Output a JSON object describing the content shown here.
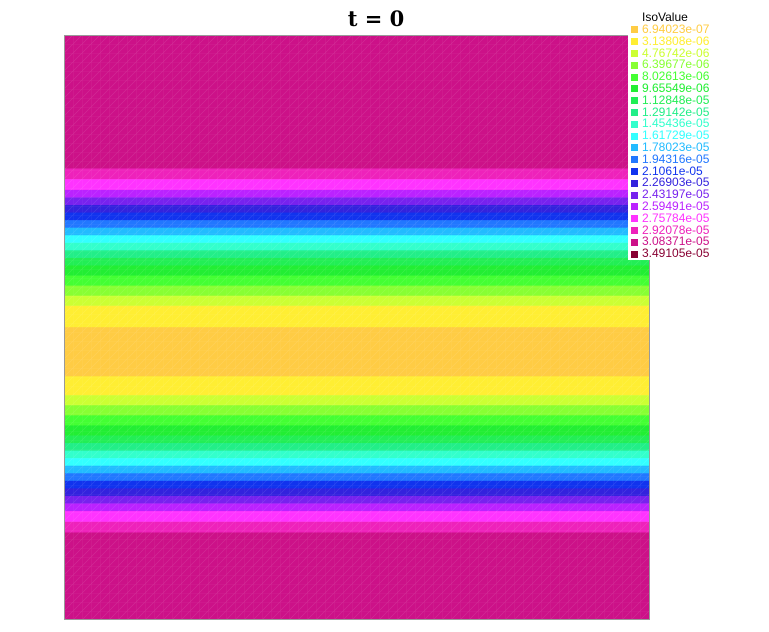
{
  "chart_data": {
    "type": "heatmap",
    "title": "t = 0",
    "legend_title": "IsoValue",
    "legend_placement": "top-right",
    "grid": false,
    "levels": [
      {
        "label": "6.94023e-07",
        "color": "#ffcc44"
      },
      {
        "label": "3.13808e-06",
        "color": "#ffee33"
      },
      {
        "label": "4.76742e-06",
        "color": "#ccff33"
      },
      {
        "label": "6.39677e-06",
        "color": "#88ff33"
      },
      {
        "label": "8.02613e-06",
        "color": "#44ff33"
      },
      {
        "label": "9.65549e-06",
        "color": "#22ee33"
      },
      {
        "label": "1.12848e-05",
        "color": "#22ee55"
      },
      {
        "label": "1.29142e-05",
        "color": "#22ee88"
      },
      {
        "label": "1.45436e-05",
        "color": "#33ffcc"
      },
      {
        "label": "1.61729e-05",
        "color": "#33ffff"
      },
      {
        "label": "1.78023e-05",
        "color": "#22bbff"
      },
      {
        "label": "1.94316e-05",
        "color": "#2277ff"
      },
      {
        "label": "2.1061e-05",
        "color": "#1133ee"
      },
      {
        "label": "2.26903e-05",
        "color": "#3322dd"
      },
      {
        "label": "2.43197e-05",
        "color": "#7722ee"
      },
      {
        "label": "2.59491e-05",
        "color": "#bb22ff"
      },
      {
        "label": "2.75784e-05",
        "color": "#ff33ff"
      },
      {
        "label": "2.92078e-05",
        "color": "#ee22bb"
      },
      {
        "label": "3.08371e-05",
        "color": "#cc1188"
      },
      {
        "label": "3.49105e-05",
        "color": "#880033"
      }
    ],
    "bands_top_to_bottom": [
      {
        "level": 18,
        "extent": 0.212
      },
      {
        "level": 17,
        "extent": 0.017
      },
      {
        "level": 16,
        "extent": 0.017
      },
      {
        "level": 15,
        "extent": 0.012
      },
      {
        "level": 14,
        "extent": 0.012
      },
      {
        "level": 13,
        "extent": 0.012
      },
      {
        "level": 12,
        "extent": 0.012
      },
      {
        "level": 11,
        "extent": 0.012
      },
      {
        "level": 10,
        "extent": 0.012
      },
      {
        "level": 9,
        "extent": 0.012
      },
      {
        "level": 8,
        "extent": 0.012
      },
      {
        "level": 7,
        "extent": 0.012
      },
      {
        "level": 6,
        "extent": 0.012
      },
      {
        "level": 5,
        "extent": 0.016
      },
      {
        "level": 4,
        "extent": 0.016
      },
      {
        "level": 3,
        "extent": 0.016
      },
      {
        "level": 2,
        "extent": 0.016
      },
      {
        "level": 1,
        "extent": 0.034
      },
      {
        "level": 0,
        "extent": 0.078
      },
      {
        "level": 1,
        "extent": 0.03
      },
      {
        "level": 2,
        "extent": 0.016
      },
      {
        "level": 3,
        "extent": 0.016
      },
      {
        "level": 4,
        "extent": 0.016
      },
      {
        "level": 5,
        "extent": 0.016
      },
      {
        "level": 6,
        "extent": 0.012
      },
      {
        "level": 7,
        "extent": 0.012
      },
      {
        "level": 8,
        "extent": 0.012
      },
      {
        "level": 9,
        "extent": 0.012
      },
      {
        "level": 10,
        "extent": 0.012
      },
      {
        "level": 11,
        "extent": 0.012
      },
      {
        "level": 12,
        "extent": 0.012
      },
      {
        "level": 13,
        "extent": 0.012
      },
      {
        "level": 14,
        "extent": 0.012
      },
      {
        "level": 15,
        "extent": 0.012
      },
      {
        "level": 16,
        "extent": 0.017
      },
      {
        "level": 17,
        "extent": 0.017
      },
      {
        "level": 18,
        "extent": 0.139
      }
    ]
  }
}
